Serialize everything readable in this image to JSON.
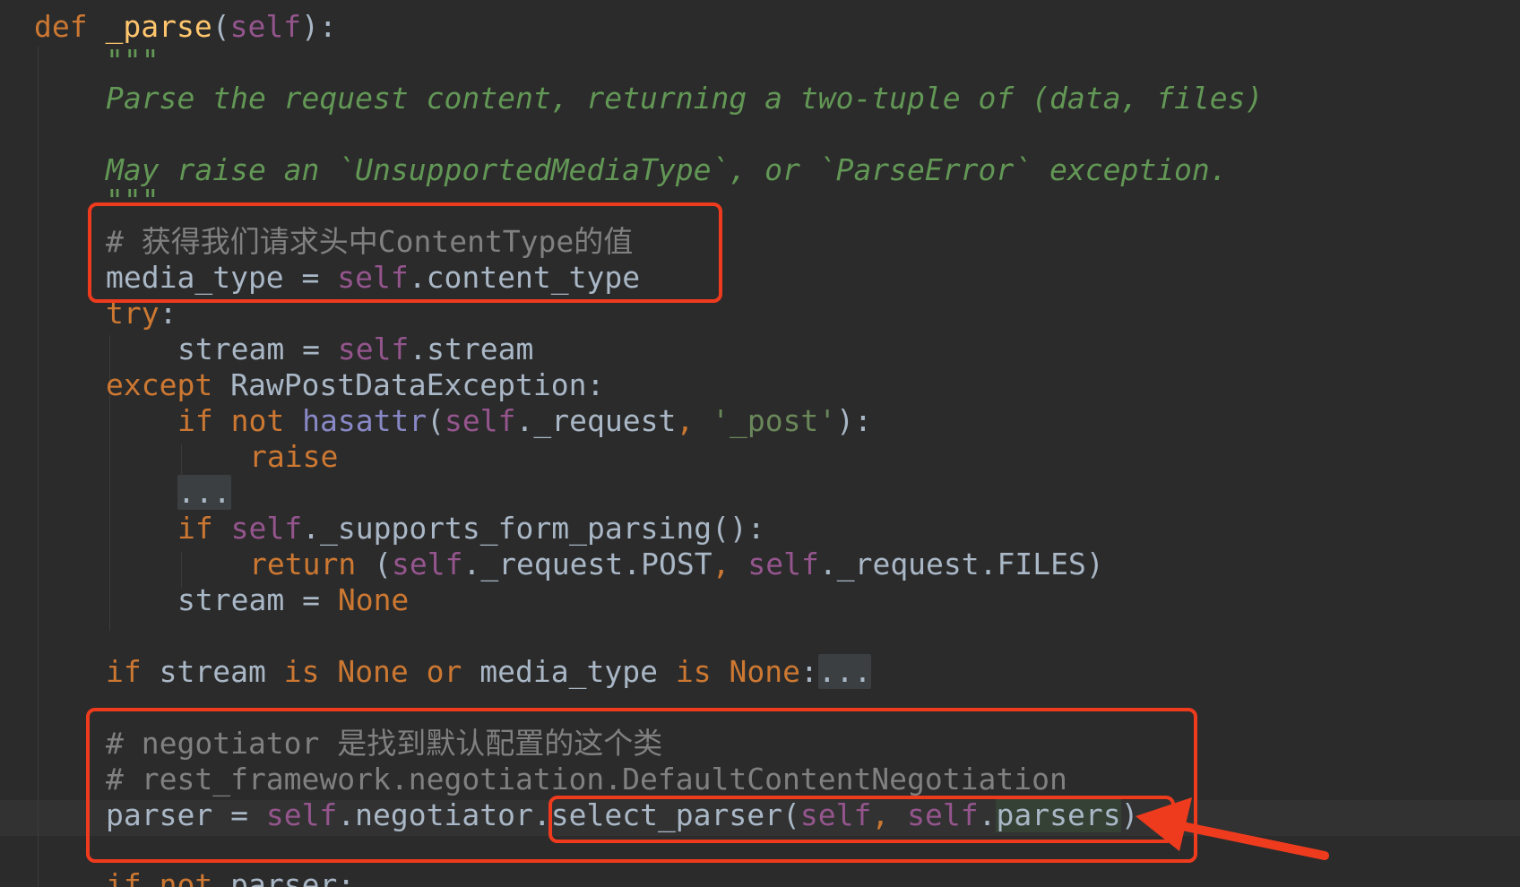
{
  "code": {
    "l1": {
      "def": "def",
      "name": "_parse",
      "open": "(",
      "self": "self",
      "close": "):"
    },
    "l2": {
      "doc_open": "\"\"\""
    },
    "l3": {
      "doc": "Parse the request content, returning a two-tuple of (data, files)"
    },
    "l5": {
      "doc": "May raise an `UnsupportedMediaType`, or `ParseError` exception."
    },
    "l6": {
      "doc_close": "\"\"\""
    },
    "l7": {
      "comment": "# 获得我们请求头中ContentType的值"
    },
    "l8": {
      "var": "media_type",
      "eq": " = ",
      "self": "self",
      "attr": ".content_type"
    },
    "l9": {
      "kw": "try",
      "colon": ":"
    },
    "l10": {
      "var": "stream",
      "eq": " = ",
      "self": "self",
      "attr": ".stream"
    },
    "l11": {
      "kw": "except",
      "exc": " RawPostDataException:"
    },
    "l12": {
      "kw_if": "if",
      "kw_not": " not ",
      "builtin": "hasattr",
      "open": "(",
      "self": "self",
      "attr": "._request",
      "comma": ", ",
      "str": "'_post'",
      "close": "):"
    },
    "l13": {
      "kw": "raise"
    },
    "l14": {
      "fold": "..."
    },
    "l15": {
      "kw_if": "if",
      "self": "self",
      "call": "._supports_form_parsing():"
    },
    "l16": {
      "kw": "return",
      "open": " (",
      "self1": "self",
      "attr1": "._request.POST",
      "comma": ", ",
      "self2": "self",
      "attr2": "._request.FILES)"
    },
    "l17": {
      "var": "stream",
      "eq": " = ",
      "none": "None"
    },
    "l19": {
      "kw_if": "if",
      "var1": " stream ",
      "kw_is": "is",
      "none1": " None ",
      "kw_or": "or",
      "var2": " media_type ",
      "kw_is2": "is",
      "none2": " None",
      "colon": ":",
      "fold": "..."
    },
    "l21": {
      "comment": "# negotiator 是找到默认配置的这个类"
    },
    "l22": {
      "comment": "# rest_framework.negotiation.DefaultContentNegotiation"
    },
    "l23": {
      "var": "parser",
      "eq": " = ",
      "self": "self",
      "attr": ".negotiator.",
      "method": "select_parser(",
      "self2": "self",
      "comma": ", ",
      "self3": "self",
      "dot": ".",
      "parsers": "parsers",
      "close": ")"
    },
    "l24": {
      "kw_if": "if",
      "kw_not": " not",
      "var": " parser:"
    }
  },
  "colors": {
    "background": "#2b2b2b",
    "keyword": "#cc7832",
    "function": "#ffc66d",
    "self": "#94558d",
    "docstring": "#629755",
    "comment": "#808080",
    "string": "#6a8759",
    "annotation_red": "#ef3b1d"
  }
}
